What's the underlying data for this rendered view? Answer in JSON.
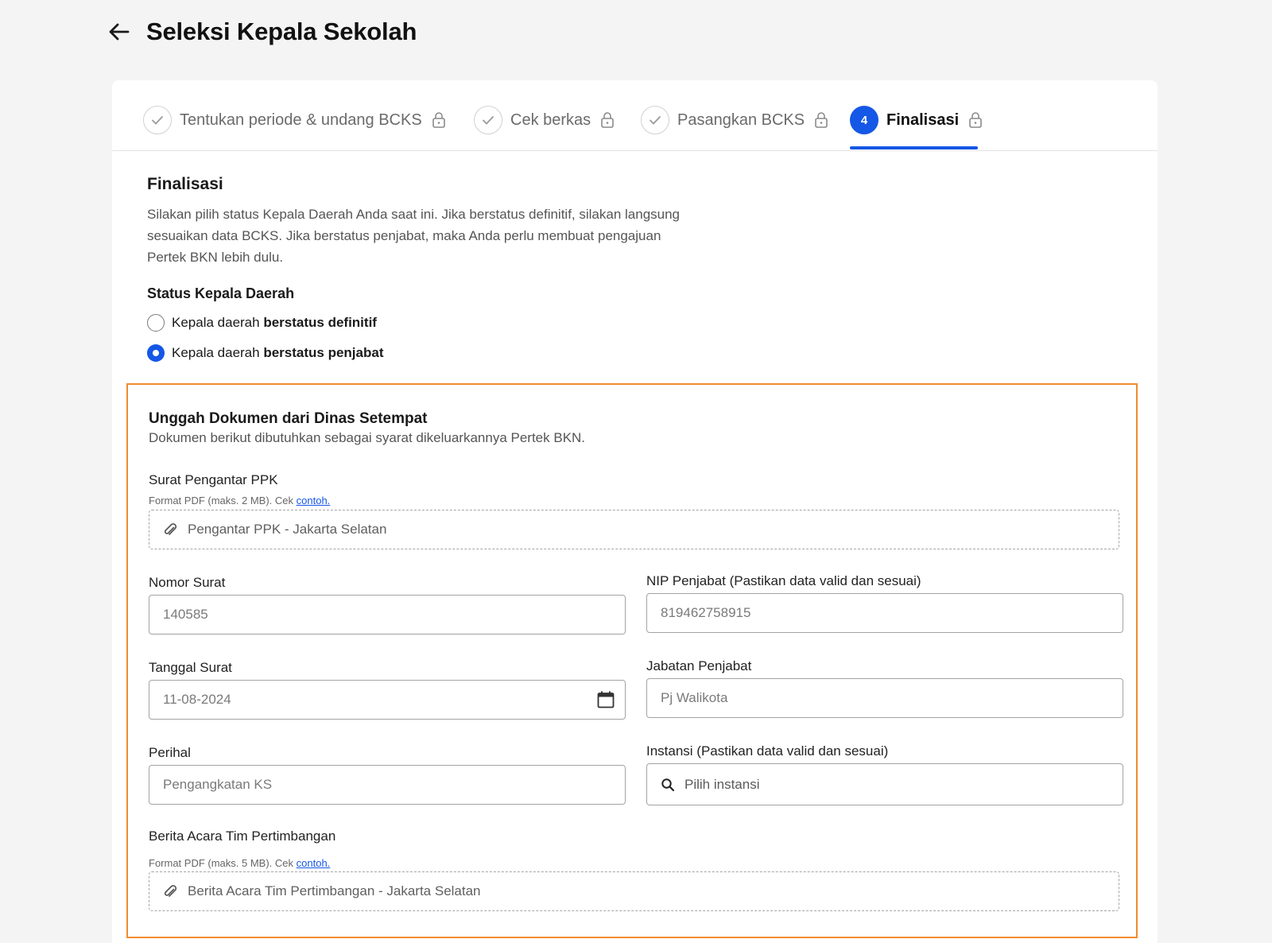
{
  "header": {
    "title": "Seleksi Kepala Sekolah"
  },
  "stepper": {
    "steps": [
      {
        "label": "Tentukan periode & undang BCKS",
        "state": "done"
      },
      {
        "label": "Cek berkas",
        "state": "done"
      },
      {
        "label": "Pasangkan BCKS",
        "state": "done"
      },
      {
        "label": "Finalisasi",
        "number": "4",
        "state": "current"
      }
    ]
  },
  "finalisasi": {
    "title": "Finalisasi",
    "description": "Silakan pilih status Kepala Daerah Anda saat ini. Jika berstatus definitif, silakan langsung sesuaikan data BCKS. Jika berstatus penjabat, maka Anda perlu membuat pengajuan Pertek BKN lebih dulu.",
    "status_label": "Status Kepala Daerah",
    "options": [
      {
        "prefix": "Kepala daerah ",
        "bold": "berstatus definitif",
        "checked": false
      },
      {
        "prefix": "Kepala daerah ",
        "bold": "berstatus penjabat",
        "checked": true
      }
    ]
  },
  "upload": {
    "title": "Unggah Dokumen dari Dinas Setempat",
    "description": "Dokumen berikut dibutuhkan sebagai syarat dikeluarkannya Pertek BKN.",
    "surat_pengantar": {
      "label": "Surat Pengantar PPK",
      "hint": "Format PDF (maks. 2 MB). Cek ",
      "hint_link": "contoh.",
      "file": "Pengantar PPK - Jakarta Selatan"
    },
    "nomor_surat": {
      "label": "Nomor Surat",
      "value": "140585"
    },
    "nip_penjabat": {
      "label": "NIP Penjabat (Pastikan data valid dan sesuai)",
      "value": "819462758915"
    },
    "tanggal_surat": {
      "label": "Tanggal Surat",
      "value": "11-08-2024"
    },
    "jabatan_penjabat": {
      "label": "Jabatan Penjabat",
      "value": "Pj Walikota"
    },
    "perihal": {
      "label": "Perihal",
      "value": "Pengangkatan KS"
    },
    "instansi": {
      "label": "Instansi (Pastikan data valid dan sesuai)",
      "placeholder": "Pilih instansi"
    },
    "berita_acara": {
      "label": "Berita Acara Tim Pertimbangan",
      "hint": "Format PDF (maks. 5 MB). Cek ",
      "hint_link": "contoh.",
      "file": "Berita Acara Tim Pertimbangan - Jakarta Selatan"
    }
  },
  "colors": {
    "primary": "#1557e6",
    "highlight_border": "#f28b30",
    "background": "#f4f4f4"
  }
}
